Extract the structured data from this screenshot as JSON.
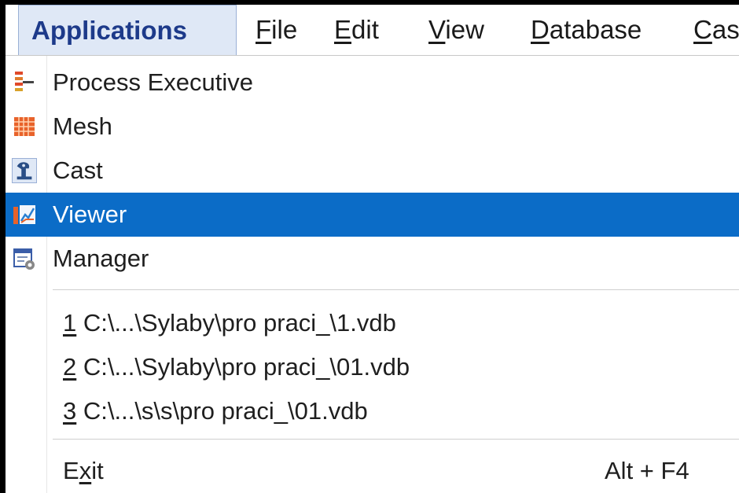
{
  "menubar": {
    "items": [
      {
        "label": "Applications",
        "active": true
      },
      {
        "label": "File",
        "mnemonic": "F"
      },
      {
        "label": "Edit",
        "mnemonic": "E"
      },
      {
        "label": "View",
        "mnemonic": "V"
      },
      {
        "label": "Database",
        "mnemonic": "D"
      },
      {
        "label": "Cas",
        "mnemonic": "C"
      }
    ]
  },
  "dropdown": {
    "apps": [
      {
        "label": "Process Executive",
        "icon": "process-executive-icon"
      },
      {
        "label": "Mesh",
        "icon": "mesh-icon"
      },
      {
        "label": "Cast",
        "icon": "cast-icon"
      },
      {
        "label": "Viewer",
        "icon": "viewer-icon",
        "highlighted": true
      },
      {
        "label": "Manager",
        "icon": "manager-icon"
      }
    ],
    "recent": [
      {
        "num": "1",
        "path": " C:\\...\\Sylaby\\pro praci_\\1.vdb"
      },
      {
        "num": "2",
        "path": " C:\\...\\Sylaby\\pro praci_\\01.vdb"
      },
      {
        "num": "3",
        "path": " C:\\...\\s\\s\\pro praci_\\01.vdb"
      }
    ],
    "exit": {
      "pre": "E",
      "mnemonic": "x",
      "post": "it",
      "shortcut": "Alt + F4"
    }
  },
  "colors": {
    "highlight": "#0b6cc7",
    "active_menu_bg": "#dfe8f6",
    "active_menu_text": "#1d3a8a"
  }
}
